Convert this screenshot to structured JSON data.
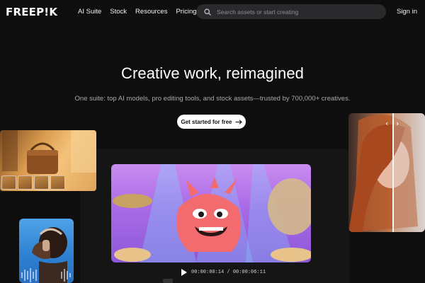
{
  "header": {
    "logo": "FREEP!K",
    "nav": [
      {
        "label": "AI Suite"
      },
      {
        "label": "Stock"
      },
      {
        "label": "Resources"
      },
      {
        "label": "Pricing"
      }
    ],
    "search_placeholder": "Search assets or start creating",
    "signin": "Sign in"
  },
  "hero": {
    "title": "Creative work, reimagined",
    "subtitle": "One suite: top AI models, pro editing tools, and stock assets—trusted by 700,000+ creatives.",
    "cta": "Get started for free"
  },
  "video": {
    "time_current": "00:00:00:14",
    "time_separator": "/",
    "time_total": "00:00:06:11"
  },
  "colors": {
    "background": "#0e0e0f",
    "search_bg": "#2a2a2c",
    "cta_bg": "#ffffff"
  }
}
